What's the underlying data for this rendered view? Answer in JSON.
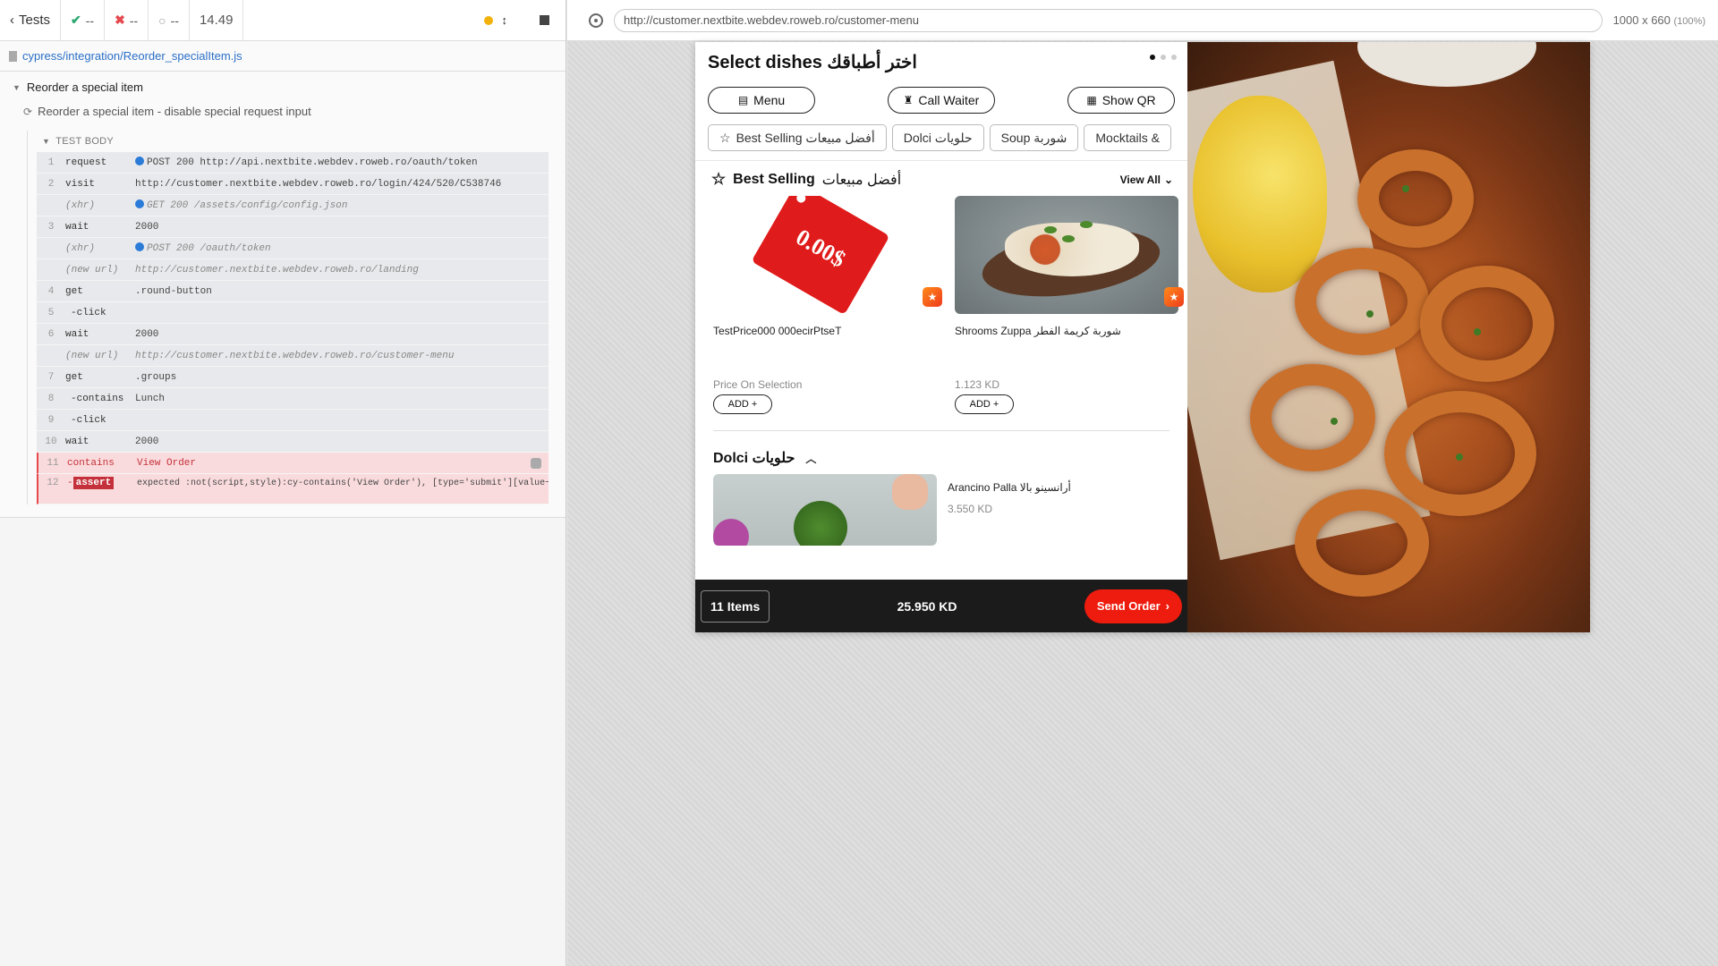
{
  "runner": {
    "tests_label": "Tests",
    "passed": "--",
    "failed": "--",
    "pending": "--",
    "duration": "14.49",
    "spec_path": "cypress/integration/Reorder_specialItem.js",
    "suite_title": "Reorder a special item",
    "test_title": "Reorder a special item - disable special request input",
    "body_label": "TEST BODY",
    "commands": [
      {
        "num": "1",
        "name": "request",
        "msg": "POST 200 http://api.nextbite.webdev.roweb.ro/oauth/token",
        "dot": true
      },
      {
        "num": "2",
        "name": "visit",
        "msg": "http://customer.nextbite.webdev.roweb.ro/login/424/520/C538746"
      },
      {
        "num": "",
        "name": "(xhr)",
        "msg": "GET 200 /assets/config/config.json",
        "dot": true,
        "muted": true
      },
      {
        "num": "3",
        "name": "wait",
        "msg": "2000"
      },
      {
        "num": "",
        "name": "(xhr)",
        "msg": "POST 200 /oauth/token",
        "dot": true,
        "muted": true
      },
      {
        "num": "",
        "name": "(new url)",
        "msg": "http://customer.nextbite.webdev.roweb.ro/landing",
        "muted": true
      },
      {
        "num": "4",
        "name": "get",
        "msg": ".round-button"
      },
      {
        "num": "5",
        "name": "-click",
        "msg": "",
        "child": true
      },
      {
        "num": "6",
        "name": "wait",
        "msg": "2000"
      },
      {
        "num": "",
        "name": "(new url)",
        "msg": "http://customer.nextbite.webdev.roweb.ro/customer-menu",
        "muted": true
      },
      {
        "num": "7",
        "name": "get",
        "msg": ".groups"
      },
      {
        "num": "8",
        "name": "-contains",
        "msg": "Lunch",
        "child": true
      },
      {
        "num": "9",
        "name": "-click",
        "msg": "",
        "child": true
      },
      {
        "num": "10",
        "name": "wait",
        "msg": "2000"
      },
      {
        "num": "11",
        "name": "contains",
        "msg": "View Order",
        "error": true
      }
    ],
    "assert_num": "12",
    "assert_dash": "-",
    "assert_label": "assert",
    "assert_message": "expected :not(script,style):cy-contains('View Order'), [type='submit'][value~='View Order'] to be visible"
  },
  "preview": {
    "url": "http://customer.nextbite.webdev.roweb.ro/customer-menu",
    "viewport": "1000 x 660",
    "zoom": "(100%)"
  },
  "app": {
    "title": "Select dishes اختر أطباقك",
    "pills": [
      "Menu",
      "Call Waiter",
      "Show QR"
    ],
    "categories": [
      "Best Selling أفضل مبيعات",
      "Dolci حلويات",
      "Soup شوربة",
      "Mocktails &"
    ],
    "section_title_en": "Best Selling",
    "section_title_ar": "أفضل مبيعات",
    "view_all": "View All",
    "products": [
      {
        "name": "TestPrice000 000ecirPtseT",
        "price": "Price On Selection",
        "add": "ADD +",
        "tag_text": "0.00$"
      },
      {
        "name": "Shrooms Zuppa شوربة كريمة الفطر",
        "price": "1.123 KD",
        "add": "ADD +"
      }
    ],
    "section2_title": "Dolci حلويات",
    "dolci_item": {
      "name": "Arancino Palla أرانسينو بالا",
      "price": "3.550 KD"
    },
    "order": {
      "items": "11 Items",
      "total": "25.950 KD",
      "send": "Send Order"
    }
  },
  "colors": {
    "accent": "#ee1c0e",
    "error": "#c4313a",
    "link": "#2a6fc7",
    "pass": "#2aa86f"
  },
  "icons": [
    "chevron-left-icon",
    "check-icon",
    "x-icon",
    "circle-icon",
    "stop-icon",
    "file-icon",
    "target-icon",
    "star-icon",
    "qr-icon",
    "waiter-icon",
    "menu-icon",
    "chevron-down-icon",
    "chevron-up-icon",
    "chevron-right-icon"
  ]
}
